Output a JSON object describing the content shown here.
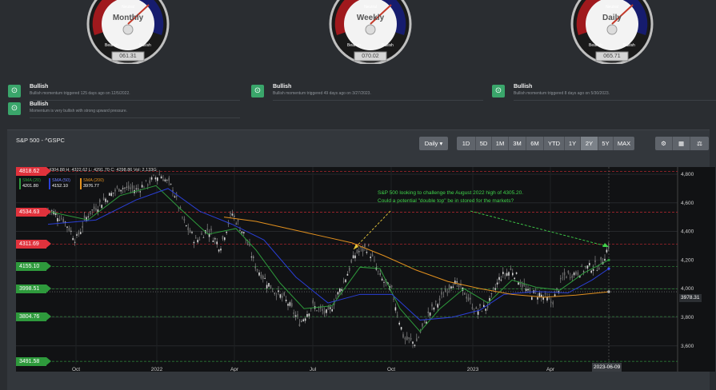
{
  "gauges": [
    {
      "label": "Monthly",
      "value": "061.31"
    },
    {
      "label": "Weekly",
      "value": "070.02"
    },
    {
      "label": "Daily",
      "value": "065.71"
    }
  ],
  "gauge_labels": {
    "neutral": "Neutral",
    "bearish": "Bearish",
    "bullish": "Bullish"
  },
  "signals": [
    {
      "title": "Bullish",
      "desc": "Bullish momentum triggered 125 days ago on 12/5/2022."
    },
    {
      "title": "Bullish",
      "desc": "Bullish momentum triggered 49 days ago on 3/27/2023."
    },
    {
      "title": "Bullish",
      "desc": "Bullish momentum triggered 8 days ago on 5/30/2023."
    },
    {
      "title": "Bullish",
      "desc": "Momentum is very bullish with strong upward pressure."
    }
  ],
  "panel": {
    "title": "S&P 500 - ^GSPC",
    "interval": "Daily",
    "ranges": [
      "1D",
      "5D",
      "1M",
      "3M",
      "6M",
      "YTD",
      "1Y",
      "2Y",
      "5Y",
      "MAX"
    ],
    "active_range": "2Y"
  },
  "ohlc": {
    "d": "2023-06-09",
    "o": "O: 4304.88",
    "h": "H: 4322.62",
    "l": "L: 4291.70",
    "c": "C: 4298.86",
    "vol": "Vol: 2.133G"
  },
  "sma_legend": [
    {
      "label": "SMA (20)",
      "value": "4201.80",
      "color": "#2e9a3c"
    },
    {
      "label": "SMA (50)",
      "value": "4152.10",
      "color": "#2a3fd6"
    },
    {
      "label": "SMA (200)",
      "value": "3976.77",
      "color": "#e2901e"
    }
  ],
  "levels": [
    {
      "label": "4818.62",
      "value": 4818.62,
      "kind": "red"
    },
    {
      "label": "4534.63",
      "value": 4534.63,
      "kind": "red"
    },
    {
      "label": "4311.69",
      "value": 4311.69,
      "kind": "red"
    },
    {
      "label": "4155.10",
      "value": 4155.1,
      "kind": "green"
    },
    {
      "label": "3998.51",
      "value": 3998.51,
      "kind": "green"
    },
    {
      "label": "3804.76",
      "value": 3804.76,
      "kind": "green"
    },
    {
      "label": "3491.58",
      "value": 3491.58,
      "kind": "green"
    }
  ],
  "annotation": [
    "S&P 500 looking to challenge the August 2022 high of 4305.20.",
    "Could a potential \"double top\" be in stored for the markets?"
  ],
  "chart_data": {
    "type": "line",
    "series": [],
    "ylim": [
      3420,
      4850
    ],
    "y_ticks": [
      "4,800",
      "4,600",
      "4,400",
      "4,200",
      "4,000",
      "3,800",
      "3,600"
    ],
    "x_ticks": [
      "Oct",
      "2022",
      "Apr",
      "Jul",
      "Oct",
      "2023",
      "Apr"
    ],
    "last_price": "3978.31",
    "last_date": "2023-06-09"
  }
}
